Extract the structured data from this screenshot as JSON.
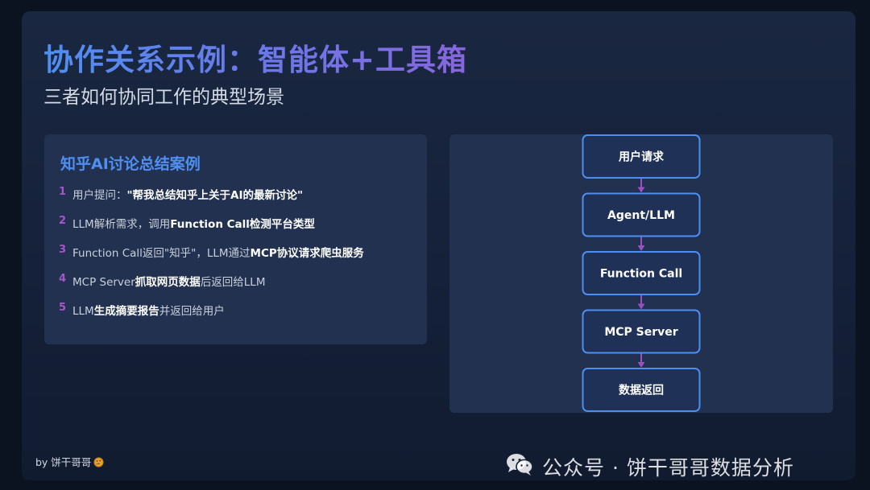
{
  "header": {
    "title": "协作关系示例：智能体+工具箱",
    "subtitle": "三者如何协同工作的典型场景"
  },
  "case_card": {
    "title": "知乎AI讨论总结案例",
    "steps": [
      {
        "num": "1",
        "parts": [
          {
            "text": "用户提问：",
            "bold": false
          },
          {
            "text": "\"帮我总结知乎上关于AI的最新讨论\"",
            "bold": true
          }
        ]
      },
      {
        "num": "2",
        "parts": [
          {
            "text": "LLM解析需求，调用",
            "bold": false
          },
          {
            "text": "Function Call检测平台类型",
            "bold": true
          }
        ]
      },
      {
        "num": "3",
        "parts": [
          {
            "text": "Function Call返回\"知乎\"，LLM通过",
            "bold": false
          },
          {
            "text": "MCP协议请求爬虫服务",
            "bold": true
          }
        ]
      },
      {
        "num": "4",
        "parts": [
          {
            "text": "MCP Server",
            "bold": false
          },
          {
            "text": "抓取网页数据",
            "bold": true
          },
          {
            "text": "后返回给LLM",
            "bold": false
          }
        ]
      },
      {
        "num": "5",
        "parts": [
          {
            "text": "LLM",
            "bold": false
          },
          {
            "text": "生成摘要报告",
            "bold": true
          },
          {
            "text": "并返回给用户",
            "bold": false
          }
        ]
      }
    ]
  },
  "flow": {
    "nodes": [
      "用户请求",
      "Agent/LLM",
      "Function Call",
      "MCP Server",
      "数据返回"
    ],
    "node_border_color": "#4d8ff0",
    "connector_color": "#9a4fc4"
  },
  "footer": {
    "byline": "by 饼干哥哥",
    "watermark": "公众号 · 饼干哥哥数据分析"
  },
  "colors": {
    "title_gradient_start": "#4f8ff2",
    "title_gradient_end": "#8766dd",
    "accent_blue": "#4f8ff2",
    "step_number": "#a457c9"
  }
}
